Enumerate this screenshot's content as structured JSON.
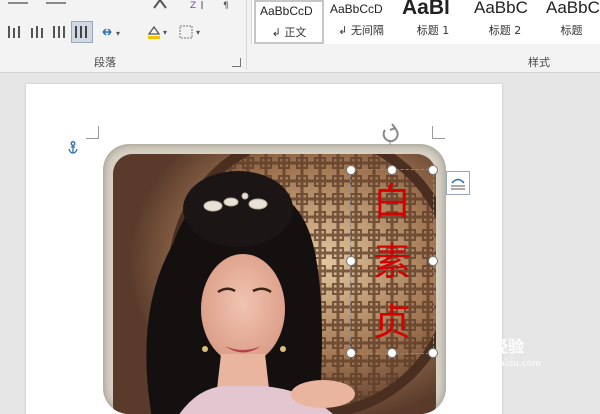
{
  "ribbon": {
    "paragraph_group_label": "段落",
    "styles_group_label": "样式",
    "styles": [
      {
        "sample": "AaBbCcD",
        "name": "↲ 正文",
        "selected": true
      },
      {
        "sample": "AaBbCcD",
        "name": "↲ 无间隔",
        "selected": false
      },
      {
        "sample": "AaBl",
        "name": "标题 1",
        "selected": false
      },
      {
        "sample": "AaBbC",
        "name": "标题 2",
        "selected": false
      },
      {
        "sample": "AaBbC",
        "name": "标题",
        "selected": false
      }
    ]
  },
  "document": {
    "textbox_text": [
      "白",
      "素",
      "贞"
    ]
  },
  "watermark": {
    "text": "Bai 经验",
    "url": "jingyan.baidu.com"
  },
  "colors": {
    "ribbon_bg": "#f3f3f3",
    "text_red": "#d60000",
    "anchor_blue": "#2e6db4"
  }
}
